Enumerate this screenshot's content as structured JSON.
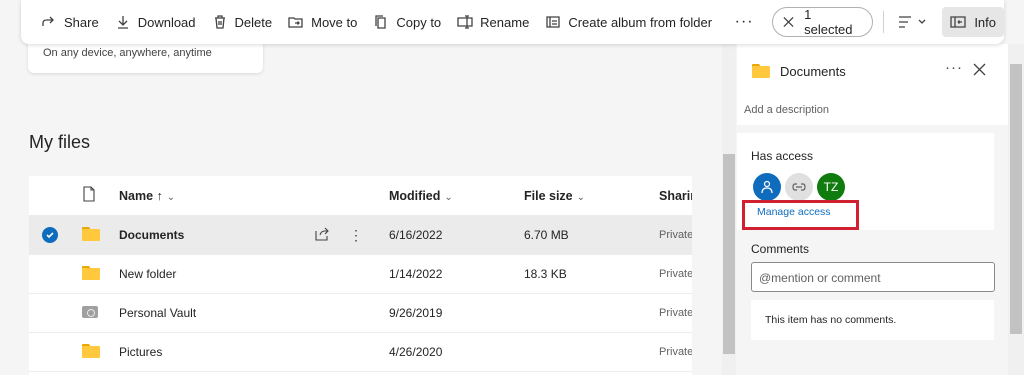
{
  "toolbar": {
    "share": "Share",
    "download": "Download",
    "delete": "Delete",
    "move_to": "Move to",
    "copy_to": "Copy to",
    "rename": "Rename",
    "create_album": "Create album from folder",
    "more": "···",
    "selected": "1 selected",
    "info": "Info"
  },
  "promo": {
    "text": "On any device, anywhere, anytime"
  },
  "page_title": "My files",
  "table": {
    "columns": {
      "name": "Name ↑",
      "modified": "Modified",
      "size": "File size",
      "sharing": "Sharing"
    },
    "rows": [
      {
        "name": "Documents",
        "modified": "6/16/2022",
        "size": "6.70 MB",
        "sharing": "Private",
        "type": "folder",
        "selected": true
      },
      {
        "name": "New folder",
        "modified": "1/14/2022",
        "size": "18.3 KB",
        "sharing": "Private",
        "type": "folder",
        "selected": false
      },
      {
        "name": "Personal Vault",
        "modified": "9/26/2019",
        "size": "",
        "sharing": "Private",
        "type": "vault",
        "selected": false
      },
      {
        "name": "Pictures",
        "modified": "4/26/2020",
        "size": "",
        "sharing": "Private",
        "type": "folder",
        "selected": false
      }
    ]
  },
  "info_pane": {
    "title": "Documents",
    "more": "···",
    "description_placeholder": "Add a description",
    "has_access": "Has access",
    "avatar_tz": "TZ",
    "manage_access": "Manage access",
    "comments": "Comments",
    "comment_placeholder": "@mention or comment",
    "no_comments": "This item has no comments."
  },
  "colors": {
    "accent": "#0f6cbd",
    "folder": "#ffc83d",
    "highlight": "#d1202f",
    "avatar_tz": "#107c10"
  }
}
